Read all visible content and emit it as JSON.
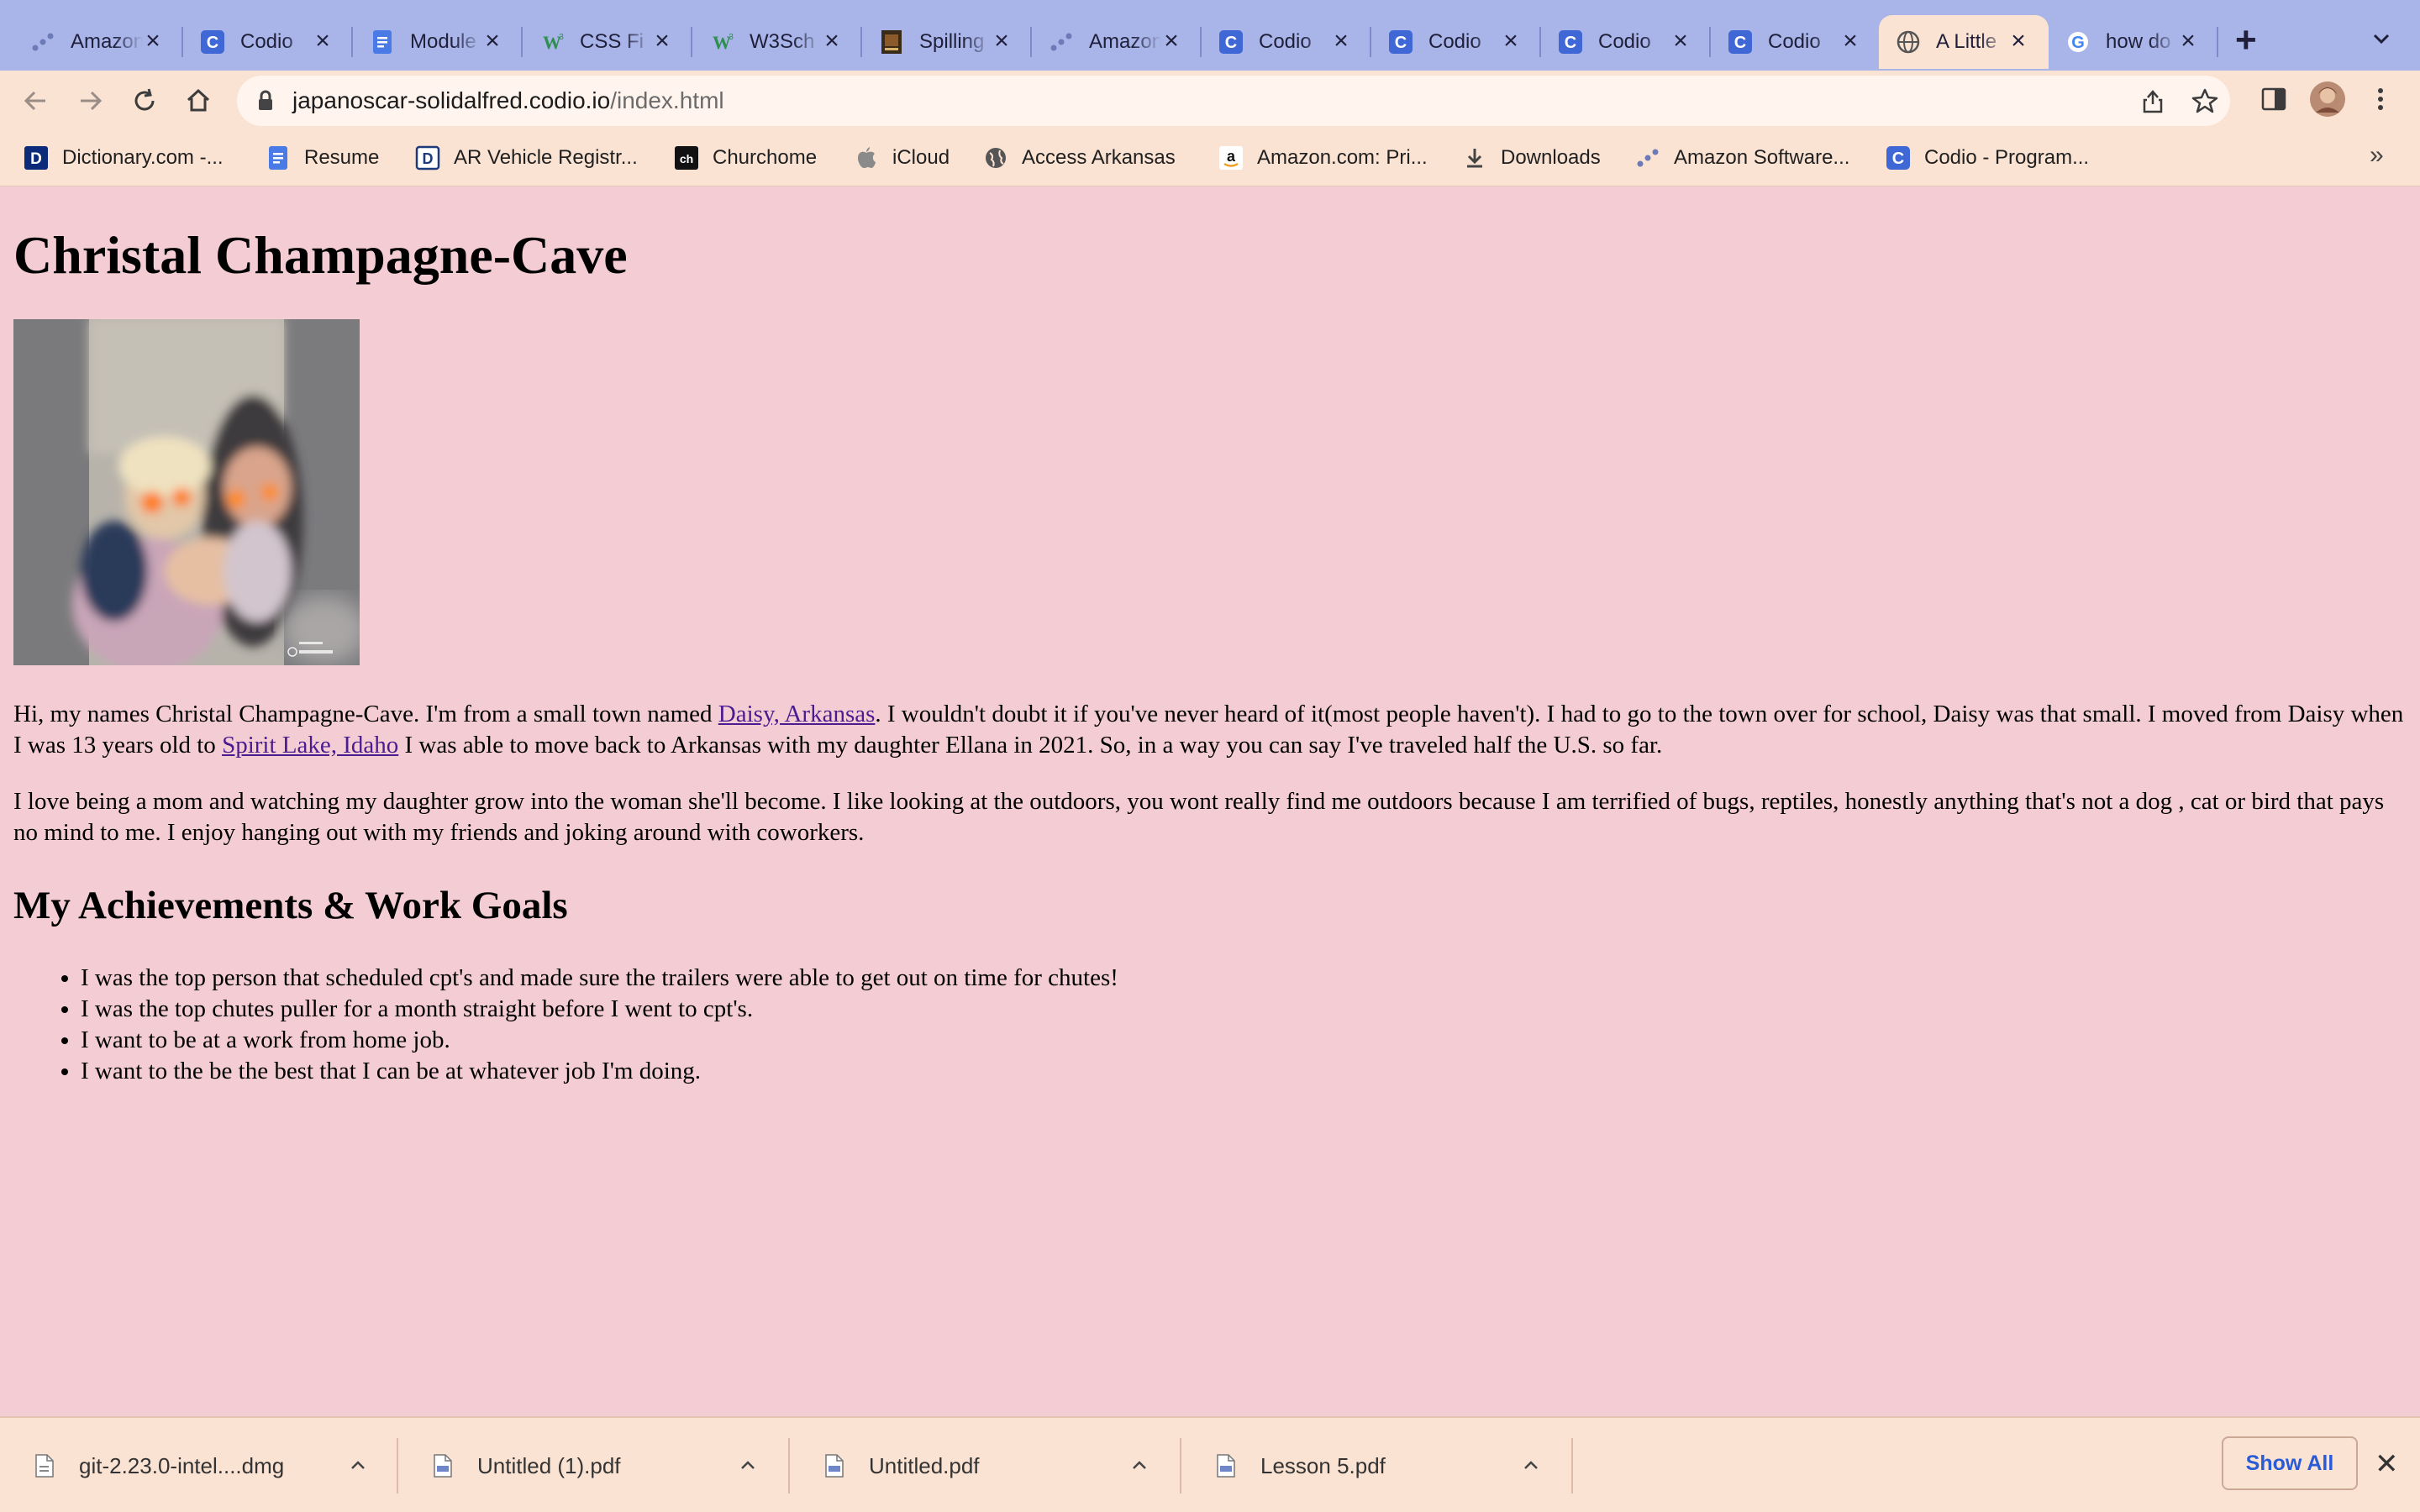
{
  "tabs": [
    {
      "title": "Amazon Software Developer",
      "icon": "amazon-dots-icon"
    },
    {
      "title": "Codio",
      "icon": "codio-icon"
    },
    {
      "title": "Module",
      "icon": "google-docs-icon"
    },
    {
      "title": "CSS Fi",
      "icon": "w3schools-icon"
    },
    {
      "title": "W3Sch",
      "icon": "w3schools-icon"
    },
    {
      "title": "Spilling",
      "icon": "book-cover-icon"
    },
    {
      "title": "Amazon",
      "icon": "amazon-dots-icon"
    },
    {
      "title": "Codio",
      "icon": "codio-icon"
    },
    {
      "title": "Codio",
      "icon": "codio-icon"
    },
    {
      "title": "Codio",
      "icon": "codio-icon"
    },
    {
      "title": "Codio",
      "icon": "codio-icon"
    },
    {
      "title": "A Little",
      "icon": "globe-icon",
      "active": true
    },
    {
      "title": "how do",
      "icon": "google-icon"
    }
  ],
  "address": {
    "host": "japanoscar-solidalfred.codio.io",
    "path": "/index.html"
  },
  "bookmarks": [
    {
      "label": "Dictionary.com -...",
      "icon": "dictionary-icon"
    },
    {
      "label": "Resume",
      "icon": "google-docs-icon"
    },
    {
      "label": "AR Vehicle Registr...",
      "icon": "ar-vehicle-icon"
    },
    {
      "label": "Churchome",
      "icon": "churchome-icon"
    },
    {
      "label": "iCloud",
      "icon": "apple-icon"
    },
    {
      "label": "Access Arkansas",
      "icon": "globe-icon"
    },
    {
      "label": "Amazon.com: Pri...",
      "icon": "amazon-icon"
    },
    {
      "label": "Downloads",
      "icon": "download-icon"
    },
    {
      "label": "Amazon Software...",
      "icon": "amazon-dots-icon"
    },
    {
      "label": "Codio - Program...",
      "icon": "codio-icon"
    }
  ],
  "page": {
    "heading": "Christal Champagne-Cave",
    "p1_before": "Hi, my names Christal Champagne-Cave. I'm from a small town named ",
    "p1_link1": "Daisy, Arkansas",
    "p1_middle": ". I wouldn't doubt it if you've never heard of it(most people haven't). I had to go to the town over for school, Daisy was that small. I moved from Daisy when I was 13 years old to ",
    "p1_link2": "Spirit Lake, Idaho",
    "p1_after": " I was able to move back to Arkansas with my daughter Ellana in 2021. So, in a way you can say I've traveled half the U.S. so far.",
    "p2": "I love being a mom and watching my daughter grow into the woman she'll become. I like looking at the outdoors, you wont really find me outdoors because I am terrified of bugs, reptiles, honestly anything that's not a dog , cat or bird that pays no mind to me. I enjoy hanging out with my friends and joking around with coworkers.",
    "subheading": "My Achievements & Work Goals",
    "goals": [
      "I was the top person that scheduled cpt's and made sure the trailers were able to get out on time for chutes!",
      "I was the top chutes puller for a month straight before I went to cpt's.",
      "I want to be at a work from home job.",
      "I want to the be the best that I can be at whatever job I'm doing."
    ]
  },
  "downloads": [
    {
      "name": "git-2.23.0-intel....dmg",
      "icon": "file-icon"
    },
    {
      "name": "Untitled (1).pdf",
      "icon": "pdf-file-icon"
    },
    {
      "name": "Untitled.pdf",
      "icon": "pdf-file-icon"
    },
    {
      "name": "Lesson 5.pdf",
      "icon": "pdf-file-icon"
    }
  ],
  "shelf": {
    "show_all": "Show All"
  },
  "colors": {
    "tabstrip": "#a9b5e8",
    "toolbar": "#fbe3d3",
    "page_background": "#f4cdd4",
    "link": "#4a1c8f",
    "show_all_text": "#2a5bd7"
  }
}
